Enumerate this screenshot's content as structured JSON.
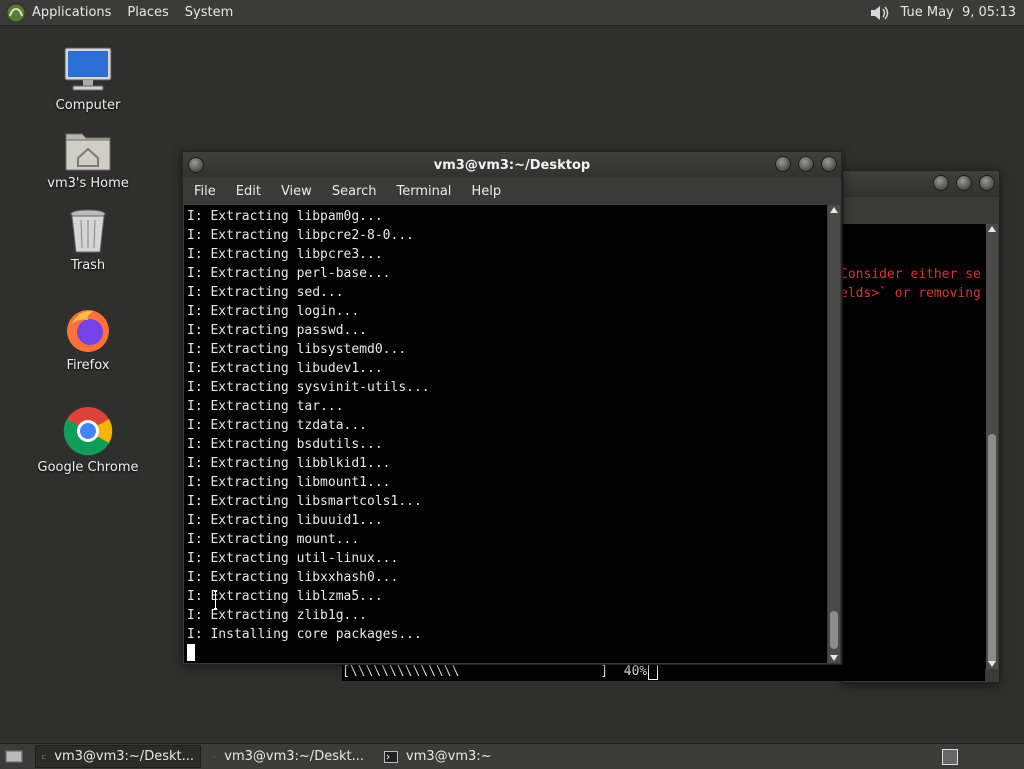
{
  "top_panel": {
    "menus": [
      "Applications",
      "Places",
      "System"
    ],
    "clock": "Tue May  9, 05:13"
  },
  "desktop_icons": [
    {
      "label": "Computer"
    },
    {
      "label": "vm3's Home"
    },
    {
      "label": "Trash"
    },
    {
      "label": "Firefox"
    },
    {
      "label": "Google Chrome"
    }
  ],
  "main_window": {
    "title": "vm3@vm3:~/Desktop",
    "menu": [
      "File",
      "Edit",
      "View",
      "Search",
      "Terminal",
      "Help"
    ],
    "lines": [
      "I: Extracting libpam0g...",
      "I: Extracting libpcre2-8-0...",
      "I: Extracting libpcre3...",
      "I: Extracting perl-base...",
      "I: Extracting sed...",
      "I: Extracting login...",
      "I: Extracting passwd...",
      "I: Extracting libsystemd0...",
      "I: Extracting libudev1...",
      "I: Extracting sysvinit-utils...",
      "I: Extracting tar...",
      "I: Extracting tzdata...",
      "I: Extracting bsdutils...",
      "I: Extracting libblkid1...",
      "I: Extracting libmount1...",
      "I: Extracting libsmartcols1...",
      "I: Extracting libuuid1...",
      "I: Extracting mount...",
      "I: Extracting util-linux...",
      "I: Extracting libxxhash0...",
      "I: Extracting liblzma5...",
      "I: Extracting zlib1g...",
      "I: Installing core packages..."
    ]
  },
  "back_window": {
    "red_lines": [
      "Consider either se",
      "elds>` or removing"
    ],
    "progress_text": "[\\\\\\\\\\\\\\\\\\\\\\\\\\\\                  ]  40%"
  },
  "taskbar": {
    "tasks": [
      "vm3@vm3:~/Deskt...",
      "vm3@vm3:~/Deskt...",
      "vm3@vm3:~"
    ]
  },
  "colors": {
    "panel": "#3b3c39",
    "desktop": "#2f302e",
    "terminal_bg": "#000000",
    "error_text": "#e0312b"
  }
}
